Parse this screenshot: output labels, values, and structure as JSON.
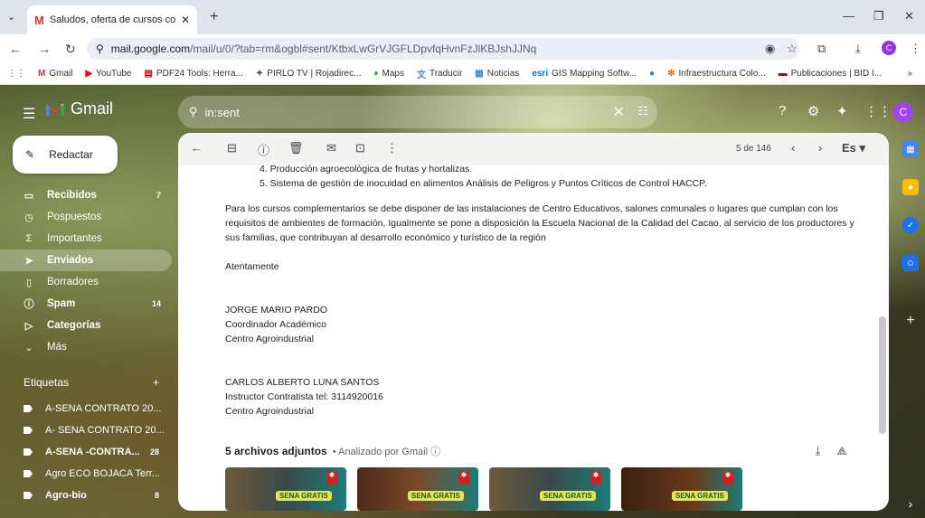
{
  "browser": {
    "tab_title": "Saludos, oferta de cursos comp",
    "url_host": "mail.google.com",
    "url_path": "/mail/u/0/?tab=rm&ogbl#sent/KtbxLwGrVJGFLDpvfqHvnFzJlKBJshJJNq",
    "bookmarks": [
      "Gmail",
      "YouTube",
      "PDF24 Tools: Herra...",
      "PIRLO TV | Rojadirec...",
      "Maps",
      "Traducir",
      "Noticias",
      "GIS Mapping Softw...",
      "Infraestructura Colo...",
      "Publicaciones | BID I..."
    ],
    "bookmarks_more": "»",
    "profile_initial": "C"
  },
  "gmail": {
    "app_name": "Gmail",
    "search_value": "in:sent",
    "compose_label": "Redactar",
    "avatar_initial": "C",
    "nav": [
      {
        "label": "Recibidos",
        "count": "7",
        "icon": "inbox-icon",
        "glyph": "▭",
        "style": "bold"
      },
      {
        "label": "Pospuestos",
        "count": "",
        "icon": "clock-icon",
        "glyph": "◷",
        "style": ""
      },
      {
        "label": "Importantes",
        "count": "",
        "icon": "important-icon",
        "glyph": "Σ",
        "style": ""
      },
      {
        "label": "Enviados",
        "count": "",
        "icon": "send-icon",
        "glyph": "➤",
        "style": "active"
      },
      {
        "label": "Borradores",
        "count": "",
        "icon": "draft-icon",
        "glyph": "▯",
        "style": ""
      },
      {
        "label": "Spam",
        "count": "14",
        "icon": "spam-icon",
        "glyph": "ⓘ",
        "style": "bold"
      },
      {
        "label": "Categorías",
        "count": "",
        "icon": "label-icon",
        "glyph": "▷",
        "style": "bold"
      },
      {
        "label": "Más",
        "count": "",
        "icon": "chevron-down-icon",
        "glyph": "⌄",
        "style": ""
      }
    ],
    "labels_header": "Etiquetas",
    "labels": [
      {
        "label": "A-SENA CONTRATO 20...",
        "count": "",
        "style": ""
      },
      {
        "label": "A- SENA CONTRATO 20...",
        "count": "",
        "style": ""
      },
      {
        "label": "A-SENA -CONTRA...",
        "count": "28",
        "style": "bold"
      },
      {
        "label": "Agro ECO BOJACA Terr...",
        "count": "",
        "style": ""
      },
      {
        "label": "Agro-bio",
        "count": "8",
        "style": "bold"
      }
    ],
    "pager": "5 de 146",
    "lang": "Es",
    "message": {
      "list": [
        "4.  Producción agroecológica de frutas y hortalizas.",
        "5.  Sistema de gestión de inocuidad en alimentos Análisis de Peligros y Puntos Críticos de Control HACCP."
      ],
      "paragraph": "Para los cursos complementarios se debe disponer de las instalaciones de Centro Educativos, salones comunales o lugares que cumplan con los requisitos de ambientes de formación, Igualmente se pone a disposición la Escuela Nacional de la Calidad del Cacao, al servicio de los productores y sus familias, que contribuyan al desarrollo económico y turístico de la región",
      "closing": "Atentamente",
      "sig1": [
        "JORGE MARIO PARDO",
        "Coordinador Académico",
        "Centro Agroindustrial"
      ],
      "sig2": [
        "CARLOS ALBERTO LUNA SANTOS",
        "Instructor Contratista tel: 3114920016",
        "Centro Agroindustrial"
      ]
    },
    "attachments_title": "5 archivos adjuntos",
    "attachments_sub": "• Analizado por Gmail ⓘ",
    "thumb_text": "SENA GRATIS"
  }
}
